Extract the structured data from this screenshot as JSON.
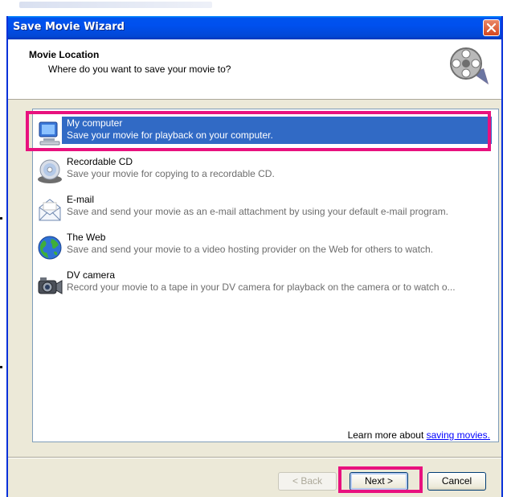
{
  "window": {
    "title": "Save Movie Wizard"
  },
  "header": {
    "title": "Movie Location",
    "subtitle": "Where do you want to save your movie to?"
  },
  "options": [
    {
      "name": "My computer",
      "desc": "Save your movie for playback on your computer.",
      "icon": "my-computer-icon",
      "selected": true
    },
    {
      "name": "Recordable CD",
      "desc": "Save your movie for copying to a recordable CD.",
      "icon": "recordable-cd-icon",
      "selected": false
    },
    {
      "name": "E-mail",
      "desc": "Save and send your movie as an e-mail attachment by using your default e-mail program.",
      "icon": "email-icon",
      "selected": false
    },
    {
      "name": "The Web",
      "desc": "Save and send your movie to a video hosting provider on the Web for others to watch.",
      "icon": "globe-icon",
      "selected": false
    },
    {
      "name": "DV camera",
      "desc": "Record your movie to a tape in your DV camera for playback on the camera or to watch o...",
      "icon": "dv-camera-icon",
      "selected": false
    }
  ],
  "learn_more": {
    "prefix": "Learn more about ",
    "link": "saving movies."
  },
  "buttons": {
    "back": "< Back",
    "next": "Next >",
    "cancel": "Cancel"
  },
  "colors": {
    "selection": "#316ac5",
    "highlight_outline": "#e8117e",
    "titlebar": "#0053ee"
  }
}
